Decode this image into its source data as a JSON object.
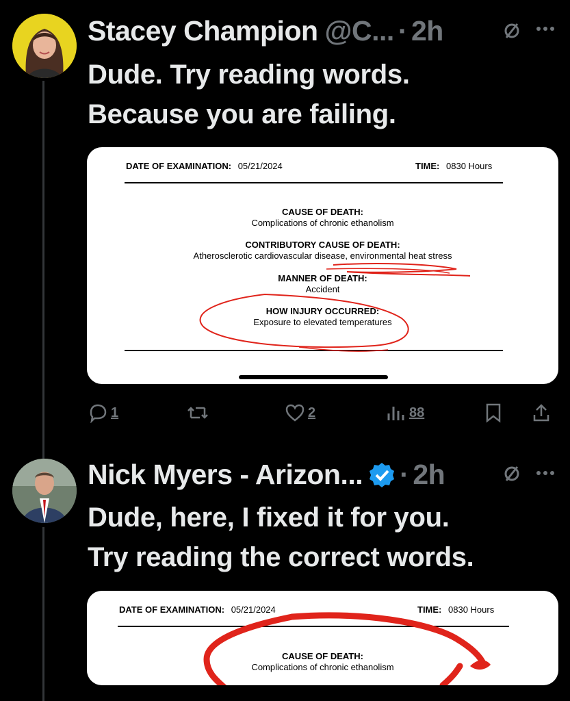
{
  "tweet1": {
    "name": "Stacey Champion",
    "handle": "@C...",
    "time": "2h",
    "text_line1": "Dude. Try reading words.",
    "text_line2": "Because you are failing.",
    "doc": {
      "date_label": "DATE OF EXAMINATION:",
      "date_value": "05/21/2024",
      "time_label": "TIME:",
      "time_value": "0830 Hours",
      "cause_label": "CAUSE OF DEATH:",
      "cause_value": "Complications of chronic ethanolism",
      "contrib_label": "CONTRIBUTORY CAUSE OF DEATH:",
      "contrib_value": "Atherosclerotic cardiovascular disease, environmental heat stress",
      "manner_label": "MANNER OF DEATH:",
      "manner_value": "Accident",
      "injury_label": "HOW INJURY OCCURRED:",
      "injury_value": "Exposure to elevated temperatures"
    },
    "actions": {
      "replies": "1",
      "likes": "2",
      "views": "88"
    }
  },
  "tweet2": {
    "name": "Nick Myers - Arizon...",
    "time": "2h",
    "text_line1": "Dude, here, I fixed it for you.",
    "text_line2": "Try reading the correct words.",
    "doc": {
      "date_label": "DATE OF EXAMINATION:",
      "date_value": "05/21/2024",
      "time_label": "TIME:",
      "time_value": "0830 Hours",
      "cause_label": "CAUSE OF DEATH:",
      "cause_value": "Complications of chronic ethanolism"
    }
  },
  "colors": {
    "background": "#000000",
    "text": "#e7e9ea",
    "muted": "#71767b",
    "verified": "#1d9bf0",
    "annotation": "#e0241b"
  },
  "icons": [
    "reply-icon",
    "retweet-icon",
    "like-icon",
    "views-icon",
    "bookmark-icon",
    "share-icon",
    "mute-icon",
    "more-icon",
    "verified-badge-icon"
  ]
}
